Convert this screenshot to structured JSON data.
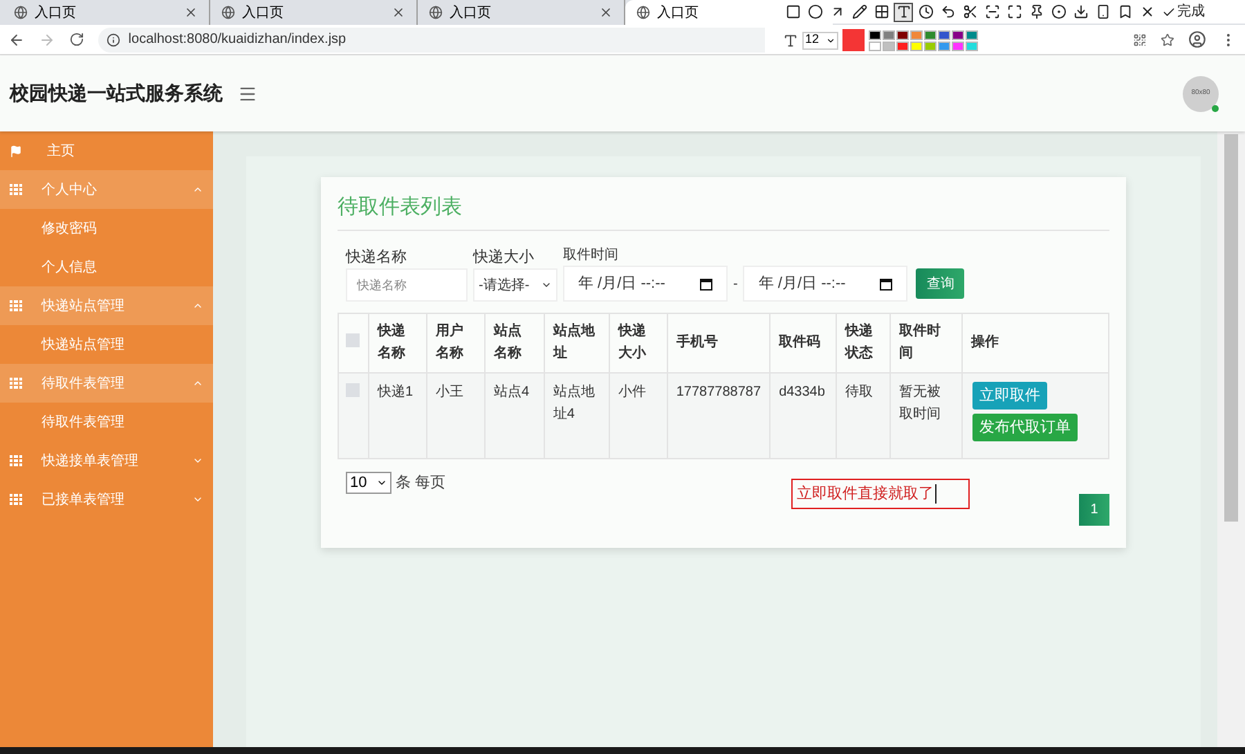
{
  "browser": {
    "tabs": [
      {
        "title": "入口页",
        "selected": false
      },
      {
        "title": "入口页",
        "selected": false
      },
      {
        "title": "入口页",
        "selected": false
      },
      {
        "title": "入口页",
        "selected": true
      }
    ],
    "address": "localhost:8080/kuaidizhan/index.jsp"
  },
  "annotation_toolbar": {
    "tools": [
      {
        "selected": false
      },
      {
        "selected": false
      },
      {
        "selected": false
      },
      {
        "selected": false
      },
      {
        "selected": false
      },
      {
        "selected": true
      },
      {
        "selected": false
      },
      {
        "selected": false
      },
      {
        "selected": false
      },
      {
        "selected": false
      },
      {
        "selected": false
      },
      {
        "selected": false
      },
      {
        "selected": false
      },
      {
        "selected": false
      },
      {
        "selected": false
      },
      {
        "selected": false
      },
      {
        "selected": false
      }
    ],
    "done_label": "完成",
    "font_size": "12",
    "palette": [
      {
        "color": "#000000"
      },
      {
        "color": "#808080"
      },
      {
        "color": "#800000"
      },
      {
        "color": "#f0883a"
      },
      {
        "color": "#2e8b2e"
      },
      {
        "color": "#3355cc"
      },
      {
        "color": "#880088"
      },
      {
        "color": "#008b8b"
      },
      {
        "color": "#ffffff"
      },
      {
        "color": "#c0c0c0"
      },
      {
        "color": "#ff2020"
      },
      {
        "color": "#ffff00"
      },
      {
        "color": "#99cc00"
      },
      {
        "color": "#3399ee"
      },
      {
        "color": "#ff33ff"
      },
      {
        "color": "#22dddd"
      }
    ]
  },
  "header": {
    "title": "校园快递一站式服务系统",
    "avatar": "80x80"
  },
  "sidebar": {
    "items": [
      {
        "label": "主页",
        "kind": "link"
      },
      {
        "label": "个人中心",
        "kind": "group",
        "expanded": true,
        "children": [
          {
            "label": "修改密码"
          },
          {
            "label": "个人信息"
          }
        ]
      },
      {
        "label": "快递站点管理",
        "kind": "group",
        "expanded": true,
        "children": [
          {
            "label": "快递站点管理"
          }
        ]
      },
      {
        "label": "待取件表管理",
        "kind": "group",
        "expanded": true,
        "children": [
          {
            "label": "待取件表管理"
          }
        ]
      },
      {
        "label": "快递接单表管理",
        "kind": "group",
        "expanded": false
      },
      {
        "label": "已接单表管理",
        "kind": "group",
        "expanded": false
      }
    ]
  },
  "card": {
    "title": "待取件表列表",
    "filters": {
      "name_label": "快递名称",
      "name_placeholder": "快递名称",
      "size_label": "快递大小",
      "size_value": "-请选择-",
      "time_label": "取件时间",
      "time_from": "年 /月/日 --:--",
      "separator": "-",
      "time_to": "年 /月/日 --:--",
      "search_button": "查询"
    },
    "table": {
      "all_checked": false,
      "columns": [
        "快递名称",
        "用户名称",
        "站点名称",
        "站点地址",
        "快递大小",
        "手机号",
        "取件码",
        "快递状态",
        "取件时间",
        "操作"
      ],
      "rows": [
        {
          "checked": false,
          "cells": [
            "快递1",
            "小王",
            "站点4",
            "站点地址4",
            "小件",
            "17787788787",
            "d4334b",
            "待取",
            "暂无被取时间"
          ],
          "actions": [
            "立即取件",
            "发布代取订单"
          ]
        }
      ]
    },
    "page_size": "10",
    "page_size_suffix": "条 每页",
    "note": "立即取件直接就取了",
    "pages": [
      {
        "label": "1",
        "selected": true
      }
    ]
  }
}
